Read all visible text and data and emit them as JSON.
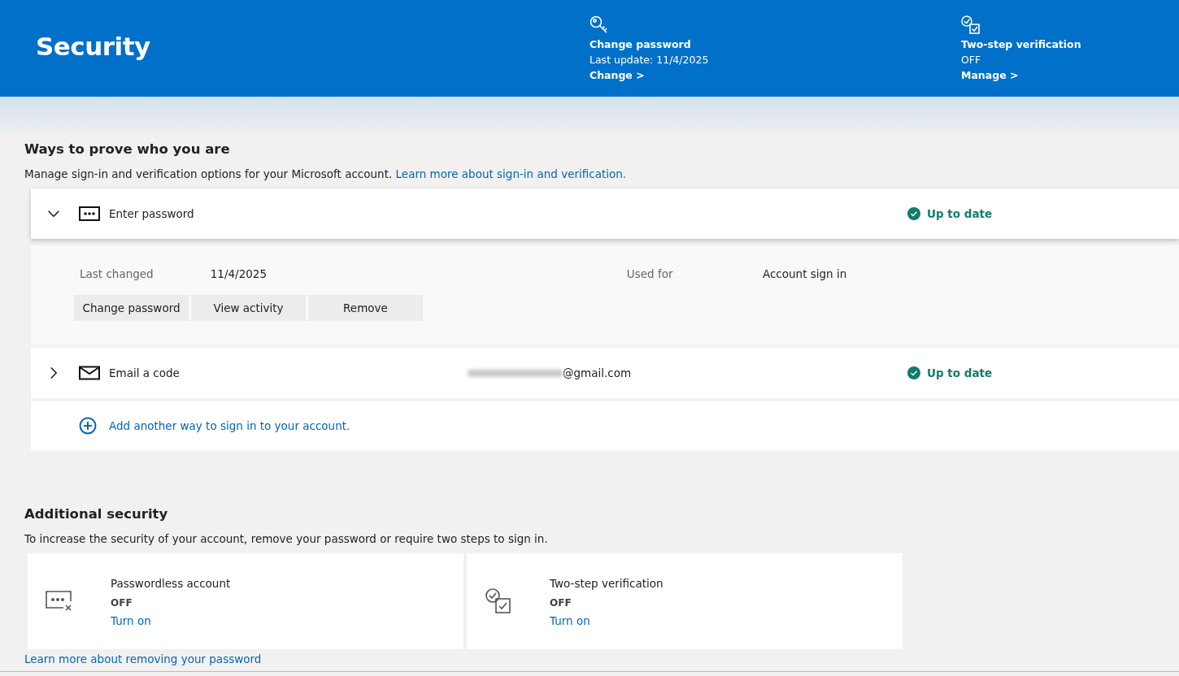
{
  "header": {
    "title": "Security",
    "tiles": [
      {
        "kind": "key",
        "title": "Change password",
        "detail": "Last update: 11/4/2025",
        "action": "Change >"
      },
      {
        "kind": "check",
        "title": "Two-step verification",
        "detail": "OFF",
        "action": "Manage >"
      }
    ]
  },
  "ways": {
    "title": "Ways to prove who you are",
    "description": "Manage sign-in and verification options for your Microsoft account.",
    "link": "Learn more about sign-in and verification.",
    "methods": [
      {
        "kind": "password",
        "label": "Enter password",
        "expanded": true,
        "status": "Up to date",
        "details": [
          {
            "label": "Last changed",
            "value": "11/4/2025"
          },
          {
            "label": "Used for",
            "value": "Account sign in"
          }
        ],
        "buttons": [
          "Change password",
          "View activity",
          "Remove"
        ]
      },
      {
        "kind": "email",
        "label": "Email a code",
        "value": "@gmail.com",
        "expanded": false,
        "status": "Up to date"
      }
    ],
    "add_link": "Add another way to sign in to your account."
  },
  "additional": {
    "title": "Additional security",
    "description": "To increase the security of your account, remove your password or require two steps to sign in.",
    "cards": [
      {
        "kind": "passwordless",
        "title": "Passwordless account",
        "state": "OFF",
        "action": "Turn on"
      },
      {
        "kind": "twostep",
        "title": "Two-step verification",
        "state": "OFF",
        "action": "Turn on"
      }
    ],
    "footer_link": "Learn more about removing your password"
  }
}
